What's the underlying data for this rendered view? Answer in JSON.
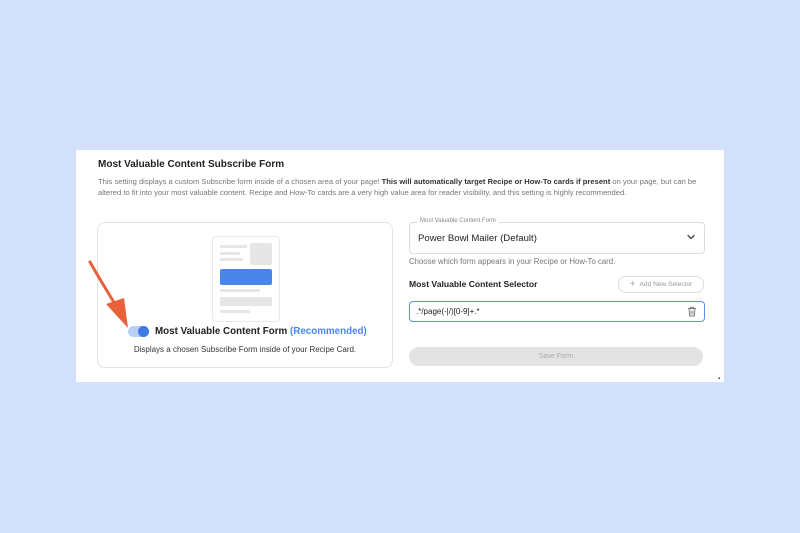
{
  "section": {
    "title": "Most Valuable Content Subscribe Form",
    "description_pre": "This setting displays a custom Subscribe form inside of a chosen area of your page! ",
    "description_bold": "This will automatically target Recipe or How-To cards if present",
    "description_post": " on your page, but can be altered to fit into your most valuable content. Recipe and How-To cards are a very high value area for reader visibility, and this setting is highly recommended."
  },
  "toggle_card": {
    "toggle_on": true,
    "label": "Most Valuable Content Form",
    "label_suffix": "(Recommended)",
    "subtitle": "Displays a chosen Subscribe Form inside of your Recipe Card."
  },
  "form_select": {
    "legend": "Most Valuable Content Form",
    "value": "Power Bowl Mailer (Default)",
    "help": "Choose which form appears in your Recipe or How-To card."
  },
  "selector": {
    "title": "Most Valuable Content Selector",
    "add_label": "Add New Selector",
    "value": ".*/page(-|/)[0-9]+.*"
  },
  "save_button": {
    "label": "Save Form"
  },
  "colors": {
    "background": "#d3e2fa",
    "accent": "#4a86ea",
    "arrow": "#e8613a"
  },
  "icons": {
    "chevron": "chevron-down-icon",
    "trash": "trash-icon",
    "plus": "plus-icon",
    "arrow": "pointer-arrow"
  }
}
